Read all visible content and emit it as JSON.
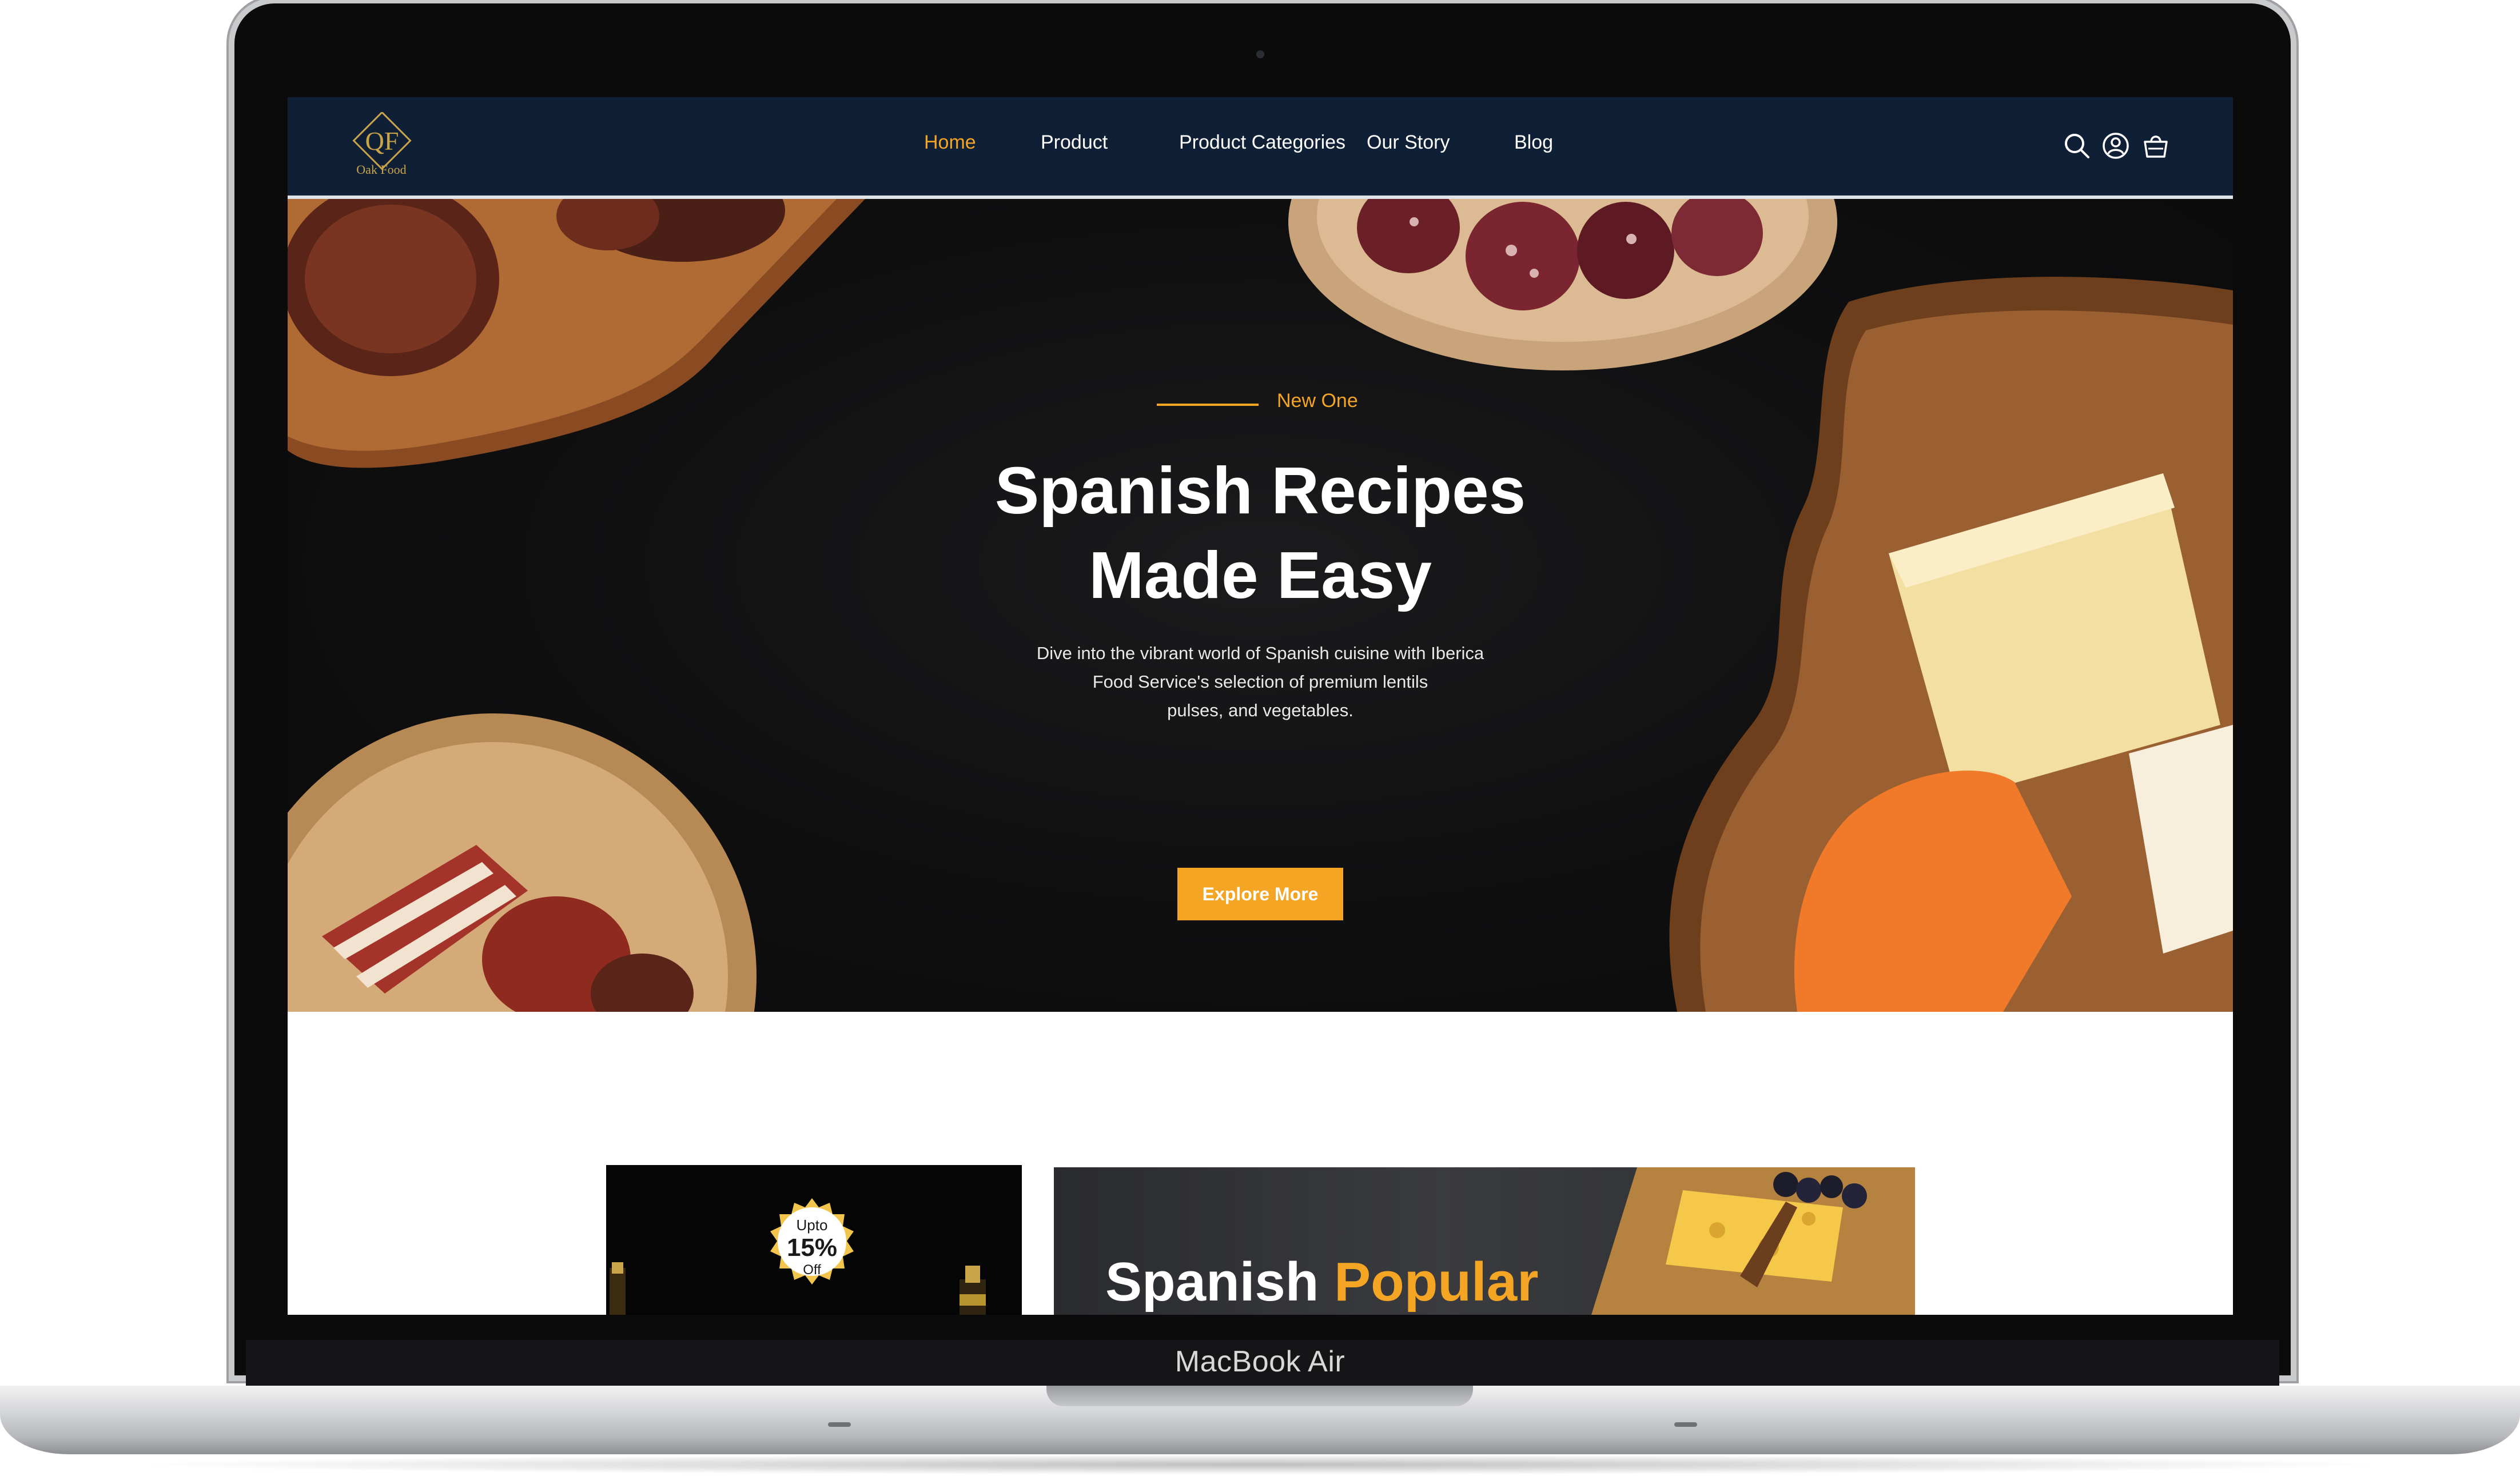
{
  "device": {
    "label": "MacBook Air"
  },
  "brand": {
    "logo_monogram": "QF",
    "logo_text": "Oak Food",
    "accent_color": "#f5a524",
    "nav_bg": "#0f1f36"
  },
  "nav": {
    "items": [
      {
        "label": "Home",
        "active": true
      },
      {
        "label": "Product",
        "active": false
      },
      {
        "label": "Product Categories",
        "active": false
      },
      {
        "label": "Our Story",
        "active": false
      },
      {
        "label": "Blog",
        "active": false
      }
    ],
    "icons": [
      "search-icon",
      "user-icon",
      "cart-icon"
    ]
  },
  "hero": {
    "eyebrow": "New One",
    "title_line1": "Spanish Recipes",
    "title_line2": "Made Easy",
    "description_line1": "Dive into the vibrant world of Spanish cuisine with Iberica",
    "description_line2": "Food Service's selection of premium lentils",
    "description_line3": "pulses, and vegetables.",
    "cta_label": "Explore More",
    "slider": {
      "count": 3,
      "active_index": 1
    }
  },
  "promos": {
    "left": {
      "badge_line1": "Upto",
      "badge_line2": "15%",
      "badge_line3": "Off"
    },
    "right": {
      "title_white": "Spanish",
      "title_accent": "Popular"
    }
  }
}
